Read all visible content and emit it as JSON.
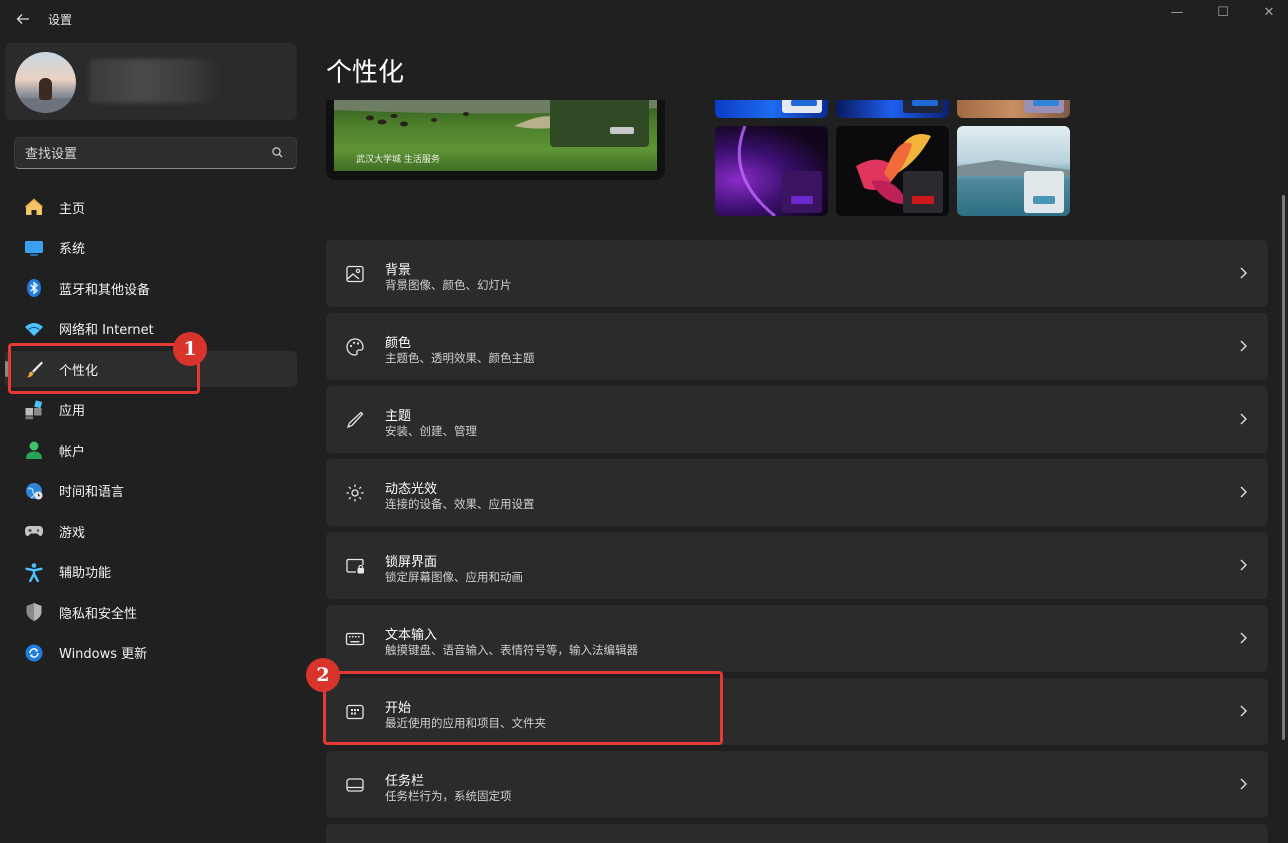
{
  "window": {
    "title": "设置",
    "controls": {
      "minimize": "—",
      "maximize": "☐",
      "close": "✕"
    }
  },
  "sidebar": {
    "search": {
      "placeholder": "查找设置"
    },
    "items": [
      {
        "label": "主页",
        "icon": "home-icon"
      },
      {
        "label": "系统",
        "icon": "system-icon"
      },
      {
        "label": "蓝牙和其他设备",
        "icon": "bluetooth-icon"
      },
      {
        "label": "网络和 Internet",
        "icon": "wifi-icon"
      },
      {
        "label": "个性化",
        "icon": "brush-icon",
        "active": true
      },
      {
        "label": "应用",
        "icon": "apps-icon"
      },
      {
        "label": "帐户",
        "icon": "account-icon"
      },
      {
        "label": "时间和语言",
        "icon": "globe-clock-icon"
      },
      {
        "label": "游戏",
        "icon": "gamepad-icon"
      },
      {
        "label": "辅助功能",
        "icon": "accessibility-icon"
      },
      {
        "label": "隐私和安全性",
        "icon": "shield-icon"
      },
      {
        "label": "Windows 更新",
        "icon": "update-icon"
      }
    ]
  },
  "main": {
    "title": "个性化",
    "preview_signature": "武汉大学城  生活服务",
    "settings": [
      {
        "title": "背景",
        "subtitle": "背景图像、颜色、幻灯片",
        "icon": "image-icon"
      },
      {
        "title": "颜色",
        "subtitle": "主题色、透明效果、颜色主题",
        "icon": "palette-icon"
      },
      {
        "title": "主题",
        "subtitle": "安装、创建、管理",
        "icon": "pen-icon"
      },
      {
        "title": "动态光效",
        "subtitle": "连接的设备、效果、应用设置",
        "icon": "dynamic-lighting-icon"
      },
      {
        "title": "锁屏界面",
        "subtitle": "锁定屏幕图像、应用和动画",
        "icon": "lock-screen-icon"
      },
      {
        "title": "文本输入",
        "subtitle": "触摸键盘、语音输入、表情符号等，输入法编辑器",
        "icon": "keyboard-icon"
      },
      {
        "title": "开始",
        "subtitle": "最近使用的应用和项目、文件夹",
        "icon": "start-icon"
      },
      {
        "title": "任务栏",
        "subtitle": "任务栏行为，系统固定项",
        "icon": "taskbar-icon"
      }
    ]
  },
  "annotations": [
    {
      "number": "1",
      "target": "个性化"
    },
    {
      "number": "2",
      "target": "开始"
    }
  ],
  "colors": {
    "background": "#202020",
    "card": "#2b2b2b",
    "highlight": "#e53935",
    "accent": "#4cc2ff"
  }
}
